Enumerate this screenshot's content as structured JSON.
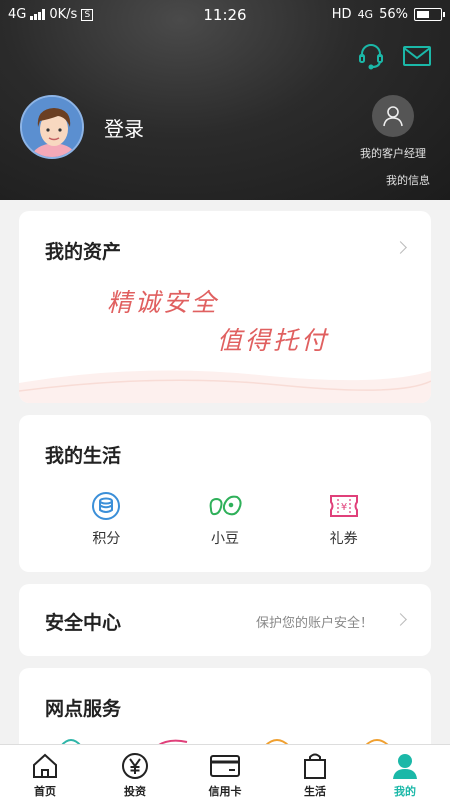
{
  "status_bar": {
    "network": "4G",
    "speed": "0K/s",
    "s_badge": "S",
    "time": "11:26",
    "hd": "HD",
    "network2": "4G",
    "battery": "56%",
    "battery_level": 0.56
  },
  "header": {
    "login_label": "登录",
    "manager_label": "我的客户经理",
    "my_info_label": "我的信息"
  },
  "assets": {
    "title": "我的资产",
    "slogan_line1": "精诚安全",
    "slogan_line2": "值得托付"
  },
  "life": {
    "title": "我的生活",
    "items": [
      {
        "label": "积分",
        "icon": "coins-icon",
        "color": "#3b8fd8"
      },
      {
        "label": "小豆",
        "icon": "beans-icon",
        "color": "#2fb05a"
      },
      {
        "label": "礼券",
        "icon": "voucher-icon",
        "color": "#e0407a"
      }
    ]
  },
  "security": {
    "title": "安全中心",
    "hint": "保护您的账户安全！"
  },
  "outlets": {
    "title": "网点服务"
  },
  "tabs": [
    {
      "label": "首页",
      "icon": "home-icon"
    },
    {
      "label": "投资",
      "icon": "yuan-icon"
    },
    {
      "label": "信用卡",
      "icon": "credit-card-icon"
    },
    {
      "label": "生活",
      "icon": "shopping-bag-icon"
    },
    {
      "label": "我的",
      "icon": "person-icon",
      "active": true
    }
  ],
  "colors": {
    "accent": "#1bb8a8",
    "slogan": "#e06060"
  }
}
